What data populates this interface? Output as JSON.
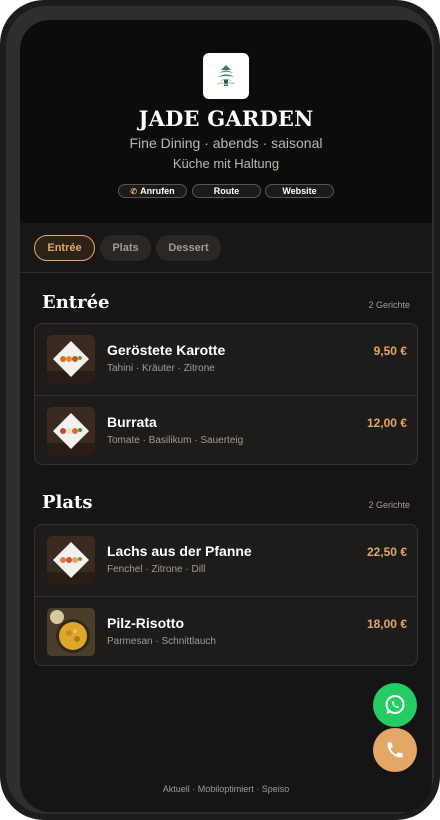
{
  "header": {
    "logo_icon": "pagoda-leaf-icon",
    "brand": "JADE GARDEN",
    "tagline": "Fine Dining · abends · saisonal",
    "subtagline": "Küche mit Haltung",
    "actions": [
      {
        "label": "Anrufen",
        "icon": "phone-icon"
      },
      {
        "label": "Route"
      },
      {
        "label": "Website"
      }
    ]
  },
  "tabs": [
    {
      "label": "Entrée",
      "active": true
    },
    {
      "label": "Plats",
      "active": false
    },
    {
      "label": "Dessert",
      "active": false
    }
  ],
  "sections": [
    {
      "title": "Entrée",
      "count": "2 Gerichte",
      "dishes": [
        {
          "name": "Geröstete Karotte",
          "desc": "Tahini · Kräuter · Zitrone",
          "price": "9,50 €",
          "thumb": "plated-dish-image"
        },
        {
          "name": "Burrata",
          "desc": "Tomate · Basilikum · Sauerteig",
          "price": "12,00 €",
          "thumb": "plated-dish-image"
        }
      ]
    },
    {
      "title": "Plats",
      "count": "2 Gerichte",
      "dishes": [
        {
          "name": "Lachs aus der Pfanne",
          "desc": "Fenchel · Zitrone · Dill",
          "price": "22,50 €",
          "thumb": "plated-dish-image"
        },
        {
          "name": "Pilz-Risotto",
          "desc": "Parmesan · Schnittlauch",
          "price": "18,00 €",
          "thumb": "risotto-bowl-image"
        }
      ]
    }
  ],
  "fabs": [
    {
      "icon": "whatsapp-icon",
      "color": "#24cc63"
    },
    {
      "icon": "phone-icon",
      "color": "#e3a866"
    }
  ],
  "footer": "Aktuell · Mobiloptimiert · Speiso",
  "colors": {
    "accent": "#e3a866",
    "background": "#161414",
    "card": "#1e1c1a"
  }
}
